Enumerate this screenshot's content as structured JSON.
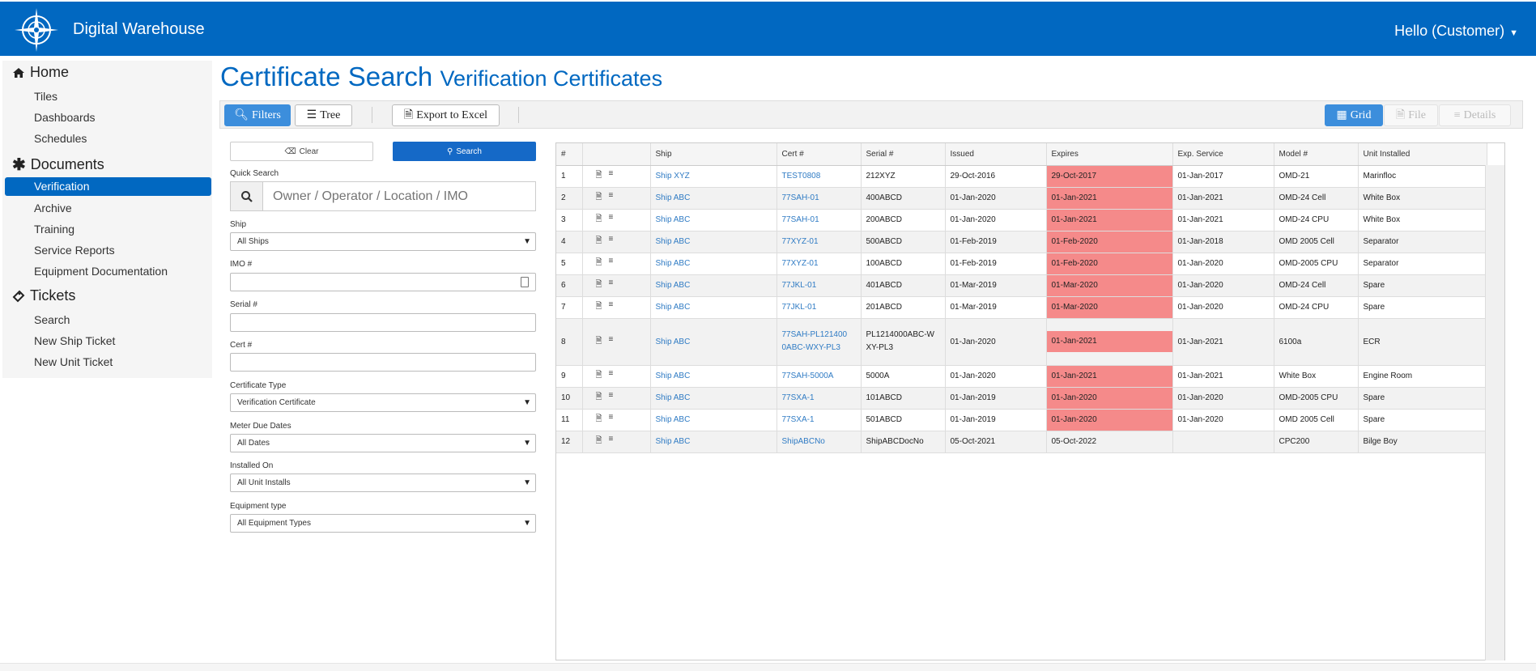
{
  "header": {
    "app_name": "Digital Warehouse",
    "user_greeting": "Hello (Customer)"
  },
  "sidebar": {
    "sections": [
      {
        "label": "Home",
        "icon": "home-icon",
        "items": [
          "Tiles",
          "Dashboards",
          "Schedules"
        ]
      },
      {
        "label": "Documents",
        "icon": "asterisk-icon",
        "items": [
          "Verification",
          "Archive",
          "Training",
          "Service Reports",
          "Equipment Documentation"
        ]
      },
      {
        "label": "Tickets",
        "icon": "ticket-icon",
        "items": [
          "Search",
          "New Ship Ticket",
          "New Unit Ticket"
        ]
      }
    ],
    "active_item": "Verification"
  },
  "page": {
    "title": "Certificate Search",
    "subtitle": "Verification Certificates"
  },
  "toolbar": {
    "filters": "Filters",
    "tree": "Tree",
    "export": "Export to Excel",
    "grid": "Grid",
    "file": "File",
    "details": "Details"
  },
  "filters": {
    "clear": "Clear",
    "search": "Search",
    "quick_search_label": "Quick Search",
    "quick_search_placeholder": "Owner / Operator / Location / IMO",
    "ship_label": "Ship",
    "ship_value": "All Ships",
    "imo_label": "IMO #",
    "serial_label": "Serial #",
    "cert_label": "Cert #",
    "cert_type_label": "Certificate Type",
    "cert_type_value": "Verification Certificate",
    "meter_label": "Meter Due Dates",
    "meter_value": "All Dates",
    "installed_label": "Installed On",
    "installed_value": "All Unit Installs",
    "equipment_label": "Equipment type",
    "equipment_value": "All Equipment Types"
  },
  "grid": {
    "columns": [
      "#",
      "",
      "Ship",
      "Cert #",
      "Serial #",
      "Issued",
      "Expires",
      "Exp. Service",
      "Model #",
      "Unit Installed"
    ],
    "rows": [
      {
        "n": "1",
        "ship": "Ship XYZ",
        "cert": "TEST0808",
        "serial": "212XYZ",
        "issued": "29-Oct-2016",
        "expires": "29-Oct-2017",
        "exp_service": "01-Jan-2017",
        "model": "OMD-21",
        "unit": "Marinfloc",
        "expired": true
      },
      {
        "n": "2",
        "ship": "Ship ABC",
        "cert": "77SAH-01",
        "serial": "400ABCD",
        "issued": "01-Jan-2020",
        "expires": "01-Jan-2021",
        "exp_service": "01-Jan-2021",
        "model": "OMD-24 Cell",
        "unit": "White Box",
        "expired": true
      },
      {
        "n": "3",
        "ship": "Ship ABC",
        "cert": "77SAH-01",
        "serial": "200ABCD",
        "issued": "01-Jan-2020",
        "expires": "01-Jan-2021",
        "exp_service": "01-Jan-2021",
        "model": "OMD-24 CPU",
        "unit": "White Box",
        "expired": true
      },
      {
        "n": "4",
        "ship": "Ship ABC",
        "cert": "77XYZ-01",
        "serial": "500ABCD",
        "issued": "01-Feb-2019",
        "expires": "01-Feb-2020",
        "exp_service": "01-Jan-2018",
        "model": "OMD 2005 Cell",
        "unit": "Separator",
        "expired": true
      },
      {
        "n": "5",
        "ship": "Ship ABC",
        "cert": "77XYZ-01",
        "serial": "100ABCD",
        "issued": "01-Feb-2019",
        "expires": "01-Feb-2020",
        "exp_service": "01-Jan-2020",
        "model": "OMD-2005 CPU",
        "unit": "Separator",
        "expired": true
      },
      {
        "n": "6",
        "ship": "Ship ABC",
        "cert": "77JKL-01",
        "serial": "401ABCD",
        "issued": "01-Mar-2019",
        "expires": "01-Mar-2020",
        "exp_service": "01-Jan-2020",
        "model": "OMD-24 Cell",
        "unit": "Spare",
        "expired": true
      },
      {
        "n": "7",
        "ship": "Ship ABC",
        "cert": "77JKL-01",
        "serial": "201ABCD",
        "issued": "01-Mar-2019",
        "expires": "01-Mar-2020",
        "exp_service": "01-Jan-2020",
        "model": "OMD-24 CPU",
        "unit": "Spare",
        "expired": true
      },
      {
        "n": "8",
        "ship": "Ship ABC",
        "cert": "77SAH-PL1214000ABC-WXY-PL3",
        "serial": "PL1214000ABC-WXY-PL3",
        "issued": "01-Jan-2020",
        "expires": "01-Jan-2021",
        "exp_service": "01-Jan-2021",
        "model": "6100a",
        "unit": "ECR",
        "expired": true,
        "tall": true
      },
      {
        "n": "9",
        "ship": "Ship ABC",
        "cert": "77SAH-5000A",
        "serial": "5000A",
        "issued": "01-Jan-2020",
        "expires": "01-Jan-2021",
        "exp_service": "01-Jan-2021",
        "model": "White Box",
        "unit": "Engine Room",
        "expired": true
      },
      {
        "n": "10",
        "ship": "Ship ABC",
        "cert": "77SXA-1",
        "serial": "101ABCD",
        "issued": "01-Jan-2019",
        "expires": "01-Jan-2020",
        "exp_service": "01-Jan-2020",
        "model": "OMD-2005 CPU",
        "unit": "Spare",
        "expired": true
      },
      {
        "n": "11",
        "ship": "Ship ABC",
        "cert": "77SXA-1",
        "serial": "501ABCD",
        "issued": "01-Jan-2019",
        "expires": "01-Jan-2020",
        "exp_service": "01-Jan-2020",
        "model": "OMD 2005 Cell",
        "unit": "Spare",
        "expired": true
      },
      {
        "n": "12",
        "ship": "Ship ABC",
        "cert": "ShipABCNo",
        "serial": "ShipABCDocNo",
        "issued": "05-Oct-2021",
        "expires": "05-Oct-2022",
        "exp_service": "",
        "model": "CPC200",
        "unit": "Bilge Boy",
        "expired": false
      }
    ]
  },
  "colors": {
    "brand": "#0168c1",
    "expired": "#f58a8a",
    "link": "#2f7bc4"
  }
}
